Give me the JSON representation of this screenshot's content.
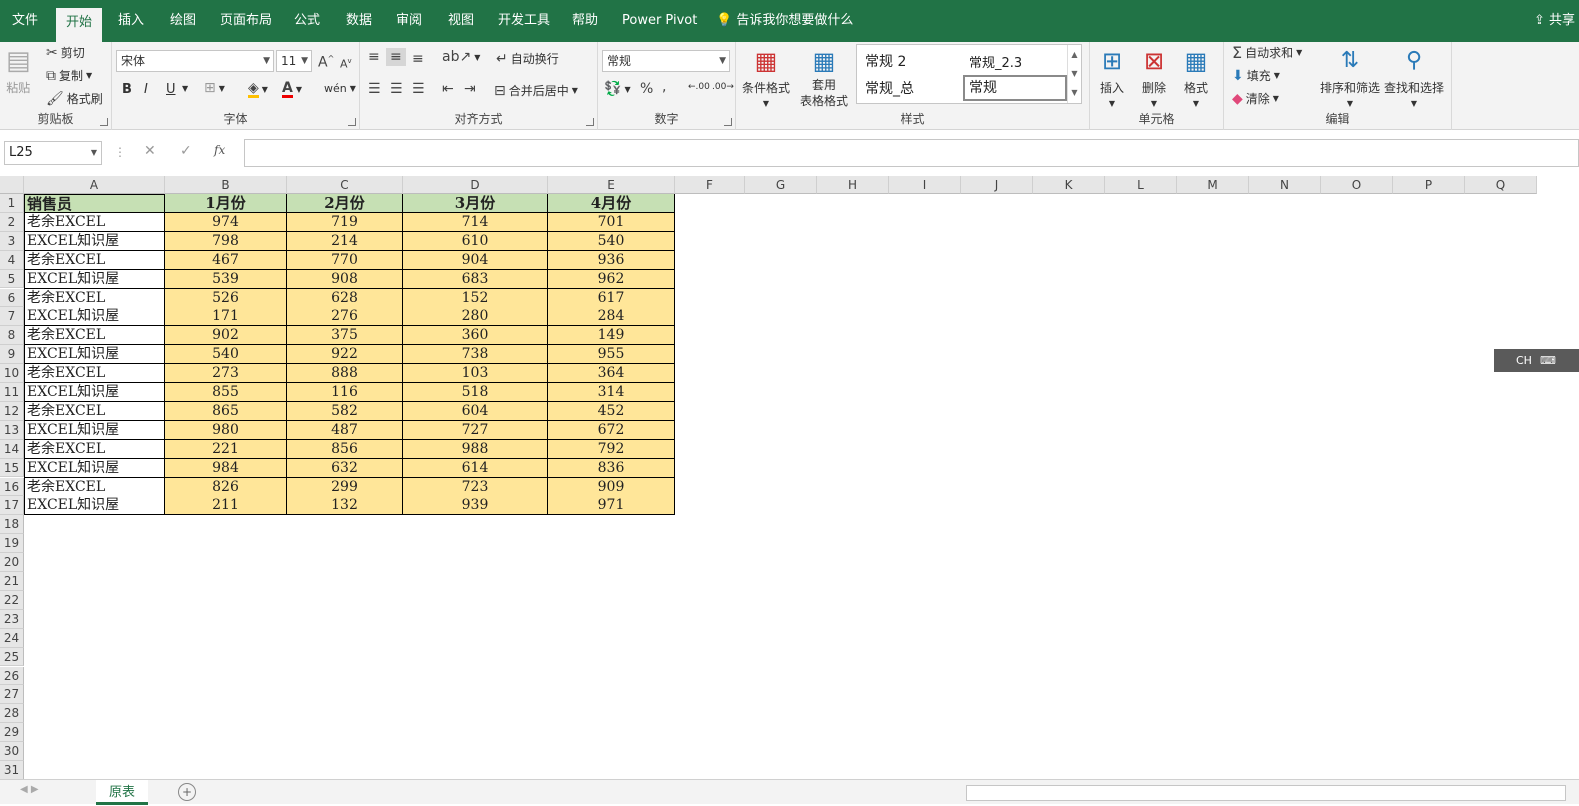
{
  "tabs": [
    "文件",
    "开始",
    "插入",
    "绘图",
    "页面布局",
    "公式",
    "数据",
    "审阅",
    "视图",
    "开发工具",
    "帮助",
    "Power Pivot"
  ],
  "tell_me": "告诉我你想要做什么",
  "share": "共享",
  "clipboard": {
    "paste": "粘贴",
    "cut": "剪切",
    "copy": "复制",
    "painter": "格式刷",
    "label": "剪贴板"
  },
  "font": {
    "name": "宋体",
    "size": "11",
    "bold": "B",
    "italic": "I",
    "underline": "U",
    "wen": "wén",
    "label": "字体"
  },
  "align": {
    "wrap": "自动换行",
    "merge": "合并后居中",
    "label": "对齐方式"
  },
  "number": {
    "format": "常规",
    "label": "数字"
  },
  "styles": {
    "cond": "条件格式",
    "table_a": "套用",
    "table_b": "表格格式",
    "s1": "常规 2",
    "s2": "常规_2.3",
    "s3": "常规_总",
    "s4": "常规",
    "label": "样式"
  },
  "cells": {
    "insert": "插入",
    "delete": "删除",
    "format": "格式",
    "label": "单元格"
  },
  "editing": {
    "autosum": "自动求和",
    "fill": "填充",
    "clear": "清除",
    "sort": "排序和筛选",
    "find": "查找和选择",
    "label": "编辑"
  },
  "namebox": "L25",
  "fx": "fx",
  "columns": [
    "A",
    "B",
    "C",
    "D",
    "E",
    "F",
    "G",
    "H",
    "I",
    "J",
    "K",
    "L",
    "M",
    "N",
    "O",
    "P",
    "Q"
  ],
  "header_row": [
    "销售员",
    "1月份",
    "2月份",
    "3月份",
    "4月份"
  ],
  "rows": [
    [
      "老余EXCEL",
      "974",
      "719",
      "714",
      "701"
    ],
    [
      "EXCEL知识屋",
      "798",
      "214",
      "610",
      "540"
    ],
    [
      "老余EXCEL",
      "467",
      "770",
      "904",
      "936"
    ],
    [
      "EXCEL知识屋",
      "539",
      "908",
      "683",
      "962"
    ],
    [
      "老余EXCEL",
      "526",
      "628",
      "152",
      "617"
    ],
    [
      "EXCEL知识屋",
      "171",
      "276",
      "280",
      "284"
    ],
    [
      "老余EXCEL",
      "902",
      "375",
      "360",
      "149"
    ],
    [
      "EXCEL知识屋",
      "540",
      "922",
      "738",
      "955"
    ],
    [
      "老余EXCEL",
      "273",
      "888",
      "103",
      "364"
    ],
    [
      "EXCEL知识屋",
      "855",
      "116",
      "518",
      "314"
    ],
    [
      "老余EXCEL",
      "865",
      "582",
      "604",
      "452"
    ],
    [
      "EXCEL知识屋",
      "980",
      "487",
      "727",
      "672"
    ],
    [
      "老余EXCEL",
      "221",
      "856",
      "988",
      "792"
    ],
    [
      "EXCEL知识屋",
      "984",
      "632",
      "614",
      "836"
    ],
    [
      "老余EXCEL",
      "826",
      "299",
      "723",
      "909"
    ],
    [
      "EXCEL知识屋",
      "211",
      "132",
      "939",
      "971"
    ]
  ],
  "row_count": 32,
  "sheet_tab": "原表",
  "ime": "CH"
}
